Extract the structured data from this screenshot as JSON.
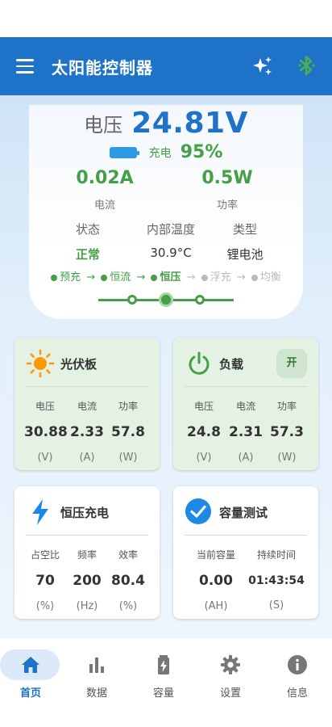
{
  "app": {
    "title": "太阳能控制器"
  },
  "icons": {
    "menu": "menu-icon",
    "sparkle": "sparkle-icon",
    "bluetooth": "bluetooth-icon"
  },
  "colors": {
    "primary": "#1e73c8",
    "green": "#43a047",
    "bluetooth": "#4caf50"
  },
  "status": {
    "voltage_label": "电压",
    "voltage_value": "24.81V",
    "charge_label": "充电",
    "charge_percent": "95%",
    "current_value": "0.02A",
    "current_label": "电流",
    "power_value": "0.5W",
    "power_label": "功率",
    "state_label": "状态",
    "state_value": "正常",
    "temp_label": "内部温度",
    "temp_value": "30.9°C",
    "type_label": "类型",
    "type_value": "锂电池",
    "stages": [
      {
        "label": "预充",
        "state": "done"
      },
      {
        "label": "恒流",
        "state": "done"
      },
      {
        "label": "恒压",
        "state": "active"
      },
      {
        "label": "浮充",
        "state": "pending"
      },
      {
        "label": "均衡",
        "state": "pending"
      }
    ],
    "stage_position": 0.5
  },
  "cards": {
    "pv": {
      "title": "光伏板",
      "icon": "sun-icon",
      "columns": [
        {
          "label": "电压",
          "value": "30.88",
          "unit": "(V)"
        },
        {
          "label": "电流",
          "value": "2.33",
          "unit": "(A)"
        },
        {
          "label": "功率",
          "value": "57.8",
          "unit": "(W)"
        }
      ]
    },
    "load": {
      "title": "负载",
      "icon": "power-icon",
      "toggle_label": "开",
      "columns": [
        {
          "label": "电压",
          "value": "24.8",
          "unit": "(V)"
        },
        {
          "label": "电流",
          "value": "2.31",
          "unit": "(A)"
        },
        {
          "label": "功率",
          "value": "57.3",
          "unit": "(W)"
        }
      ]
    },
    "charge_mode": {
      "title": "恒压充电",
      "icon": "bolt-icon",
      "columns": [
        {
          "label": "占空比",
          "value": "70",
          "unit": "(%)"
        },
        {
          "label": "频率",
          "value": "200",
          "unit": "(Hz)"
        },
        {
          "label": "效率",
          "value": "80.4",
          "unit": "(%)"
        }
      ]
    },
    "capacity": {
      "title": "容量测试",
      "icon": "check-circle-icon",
      "columns": [
        {
          "label": "当前容量",
          "value": "0.00",
          "unit": "(AH)"
        },
        {
          "label": "持续时间",
          "value": "01:43:54",
          "unit": "(S)"
        }
      ]
    }
  },
  "nav": {
    "items": [
      {
        "label": "首页",
        "icon": "home-icon",
        "active": true
      },
      {
        "label": "数据",
        "icon": "bar-chart-icon",
        "active": false
      },
      {
        "label": "容量",
        "icon": "battery-icon",
        "active": false
      },
      {
        "label": "设置",
        "icon": "gear-icon",
        "active": false
      },
      {
        "label": "信息",
        "icon": "info-icon",
        "active": false
      }
    ]
  }
}
